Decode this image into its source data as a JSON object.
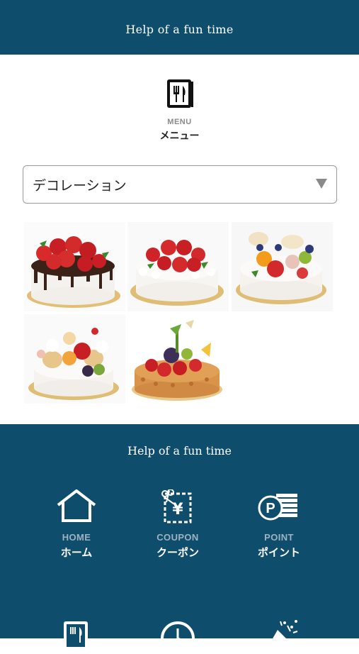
{
  "header": {
    "title": "Help of a fun time"
  },
  "menu_section": {
    "icon": "fork-knife-icon",
    "label_en": "MENU",
    "label_jp": "メニュー"
  },
  "category_select": {
    "selected": "デコレーション"
  },
  "products": [
    {
      "name": "chocolate-strawberry-cake"
    },
    {
      "name": "strawberry-shortcake"
    },
    {
      "name": "fruit-decoration-cake"
    },
    {
      "name": "character-fruit-cake"
    },
    {
      "name": "fruit-tart-cake"
    }
  ],
  "footer": {
    "title": "Help of a fun time",
    "nav": [
      {
        "icon": "home-icon",
        "label_en": "HOME",
        "label_jp": "ホーム"
      },
      {
        "icon": "coupon-icon",
        "label_en": "COUPON",
        "label_jp": "クーポン"
      },
      {
        "icon": "point-icon",
        "label_en": "POINT",
        "label_jp": "ポイント"
      },
      {
        "icon": "menu-icon",
        "label_en": "",
        "label_jp": ""
      },
      {
        "icon": "clock-icon",
        "label_en": "",
        "label_jp": ""
      },
      {
        "icon": "party-popper-icon",
        "label_en": "",
        "label_jp": ""
      }
    ]
  },
  "colors": {
    "brand": "#0f4d6d",
    "nav_en": "#9db3c2"
  }
}
